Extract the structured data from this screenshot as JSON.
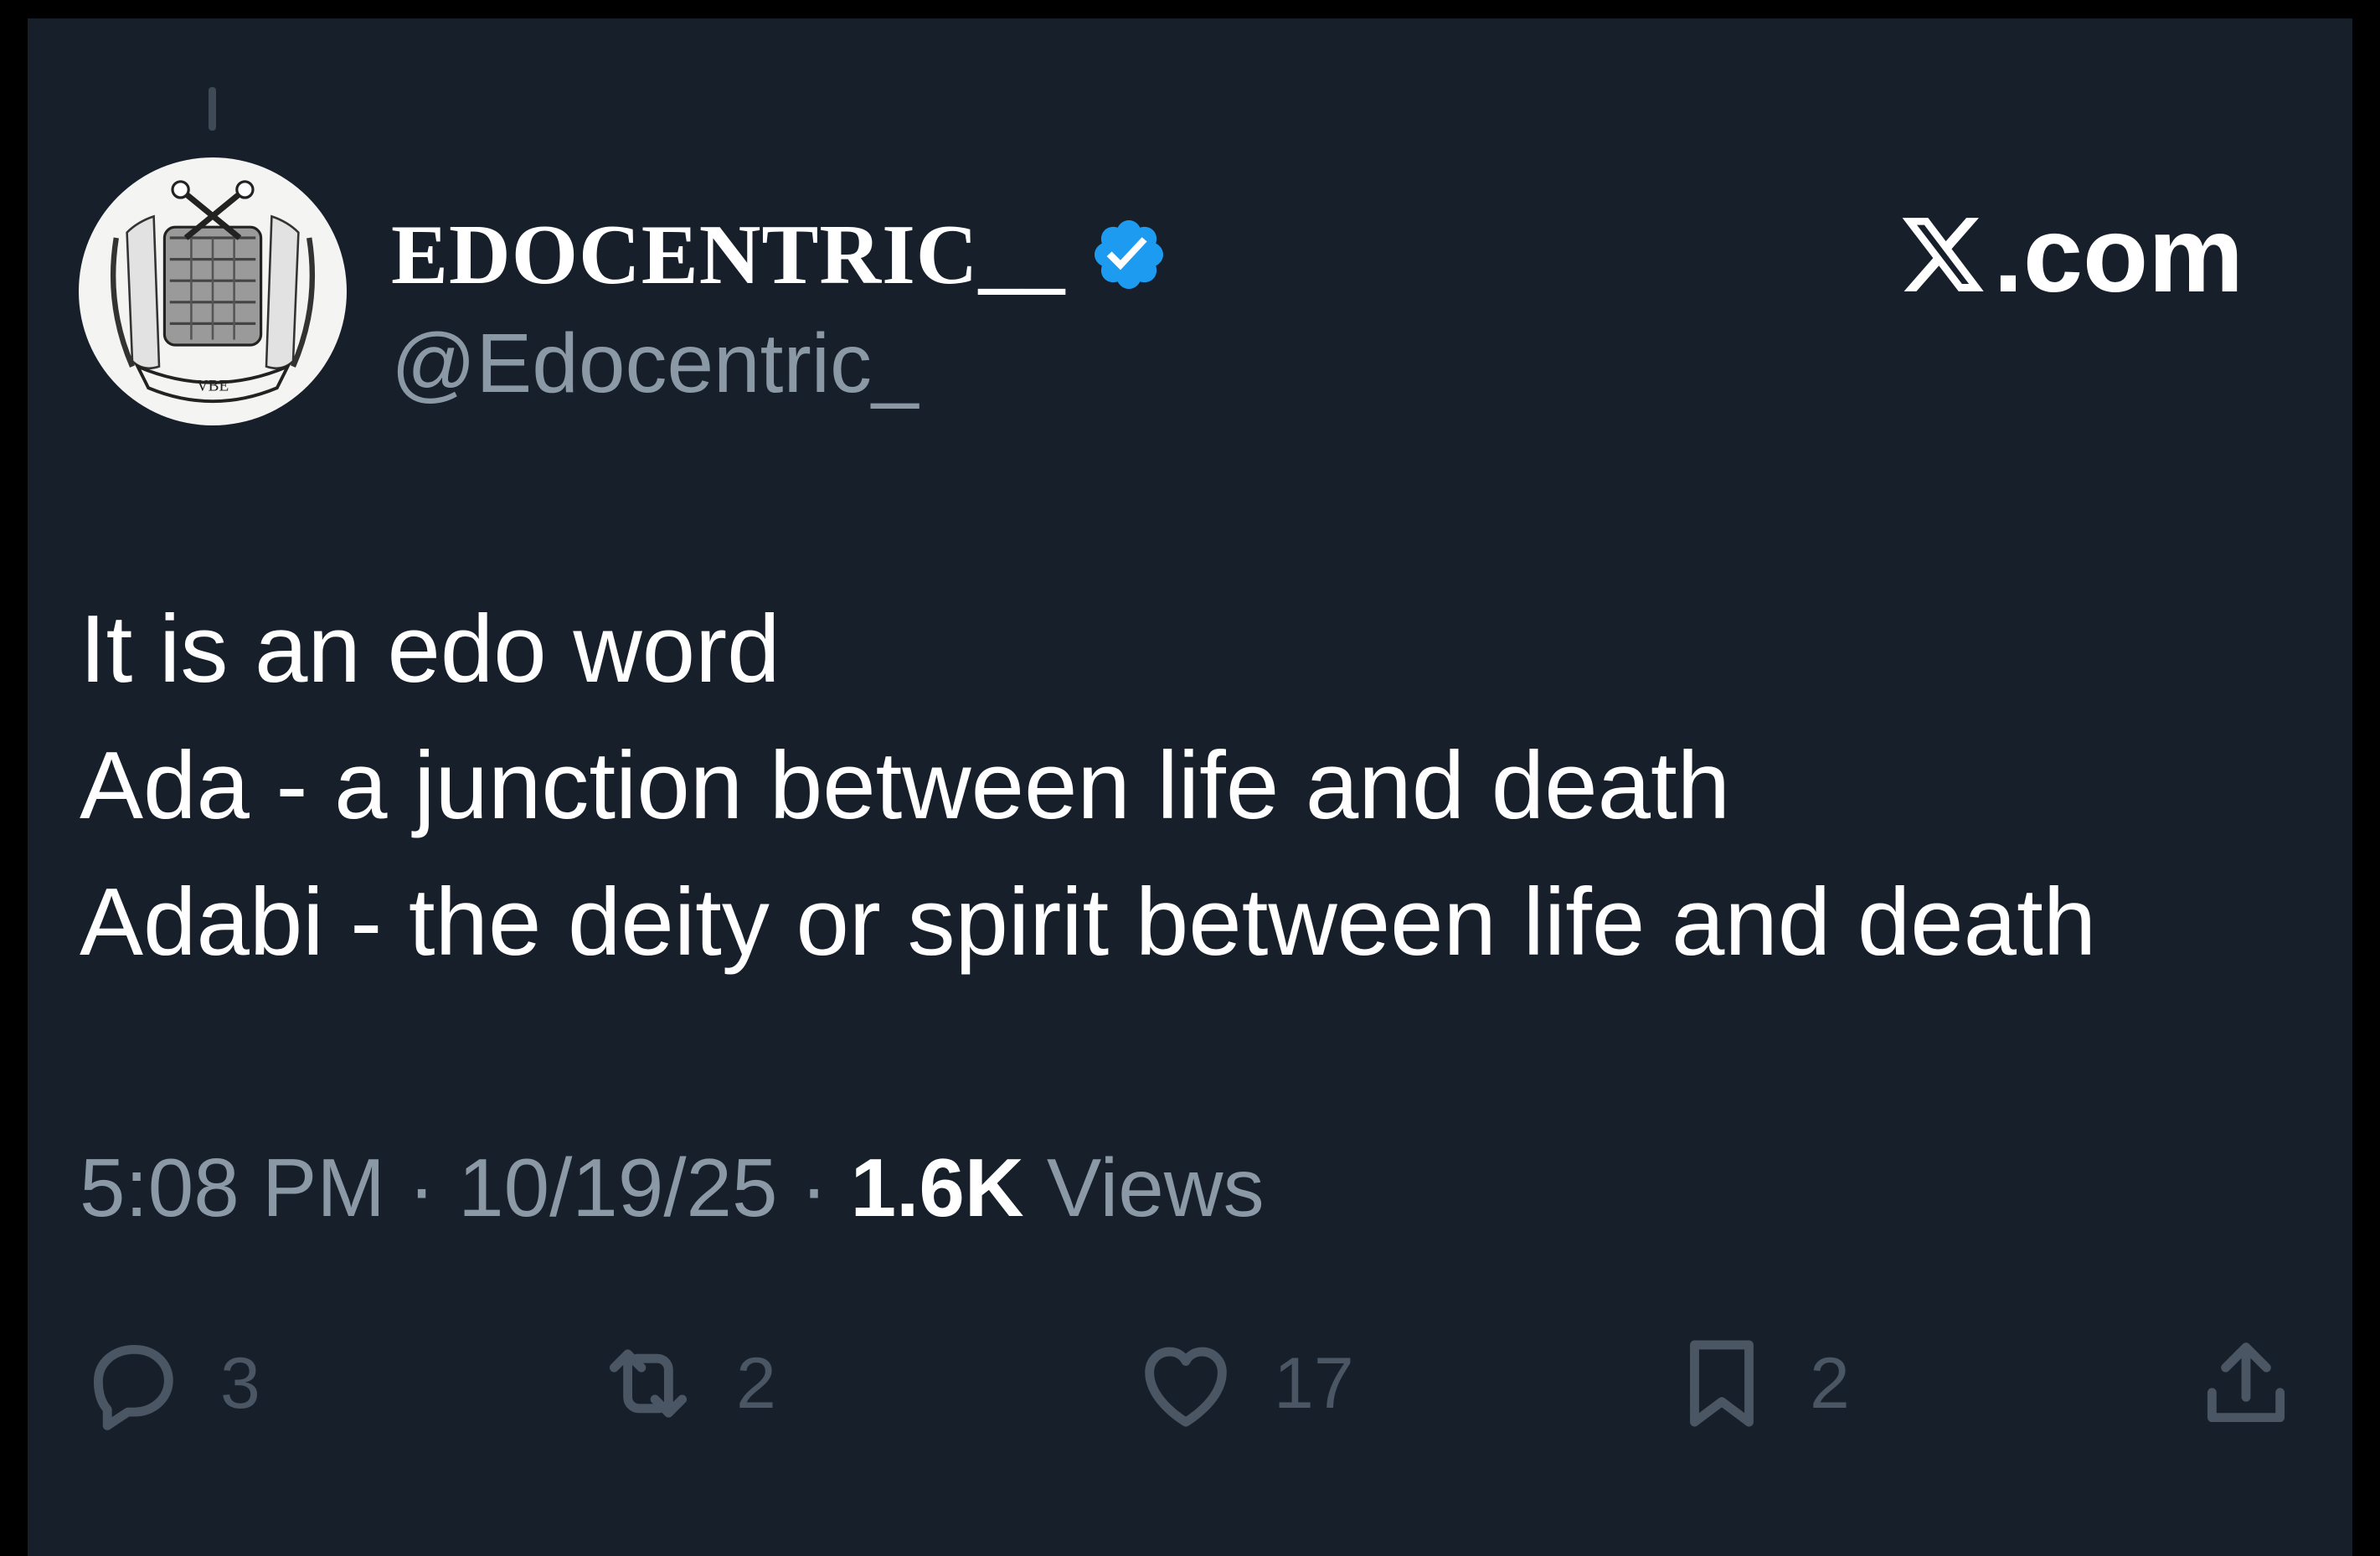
{
  "author": {
    "display_name": "EDOCENTRIC__",
    "handle": "@Edocentric_",
    "verified": true,
    "avatar_caption": "VBE"
  },
  "brand": {
    "label": ".com",
    "icon": "x-logo-icon"
  },
  "tweet": {
    "lines": [
      "It is an edo word",
      "Ada - a junction between life and death",
      "Adabi - the deity or spirit between life and death"
    ]
  },
  "meta": {
    "time": "5:08 PM",
    "separator": "·",
    "date": "10/19/25",
    "views_count": "1.6K",
    "views_label": "Views"
  },
  "actions": {
    "reply_count": "3",
    "repost_count": "2",
    "like_count": "17",
    "bookmark_count": "2"
  },
  "colors": {
    "background": "#17202a",
    "verified_badge": "#1d9bf0",
    "secondary_text": "#8b98a5",
    "action_icons": "#4a5663"
  }
}
